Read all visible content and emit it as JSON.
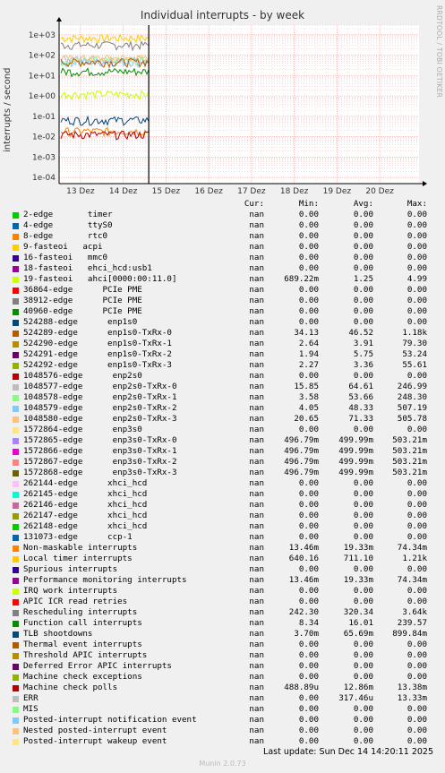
{
  "title": "Individual interrupts - by week",
  "side_credit": "RRDTOOL / TOBI OETIKER",
  "footer": "Last update: Sun Dec 14 14:20:11 2025",
  "version": "Munin 2.0.73",
  "headers": {
    "cur": "Cur:",
    "min": "Min:",
    "avg": "Avg:",
    "max": "Max:"
  },
  "chart_data": {
    "type": "line",
    "ylabel": "interrupts / second",
    "yscale": "log",
    "ylim": [
      5e-05,
      3000
    ],
    "yticks": [
      "1e-04",
      "1e-03",
      "1e-02",
      "1e-01",
      "1e+00",
      "1e+01",
      "1e+02",
      "1e+03"
    ],
    "xticks": [
      "13 Dez",
      "14 Dez",
      "15 Dez",
      "16 Dez",
      "17 Dez",
      "18 Dez",
      "19 Dez",
      "20 Dez"
    ],
    "now_marker": "14 Dez 14:20",
    "grid": true,
    "series": [
      {
        "name": "Local timer interrupts",
        "level": 700
      },
      {
        "name": "Rescheduling interrupts",
        "level": 320
      },
      {
        "name": "1048577-edge enp2s0-TxRx-0",
        "level": 65
      },
      {
        "name": "1048578-edge enp2s0-TxRx-1",
        "level": 54
      },
      {
        "name": "1048579-edge enp2s0-TxRx-2",
        "level": 48
      },
      {
        "name": "1048580-edge enp2s0-TxRx-3",
        "level": 71
      },
      {
        "name": "524289-edge enp1s0-TxRx-0",
        "level": 47
      },
      {
        "name": "Function call interrupts",
        "level": 16
      },
      {
        "name": "19-fasteoi ahci[0000:00:11.0]",
        "level": 1.25
      },
      {
        "name": "TLB shootdowns",
        "level": 0.066
      },
      {
        "name": "Non-maskable interrupts",
        "level": 0.019
      },
      {
        "name": "Machine check polls",
        "level": 0.013
      }
    ]
  },
  "rows": [
    {
      "name": "2-edge       timer",
      "color": "#00cc00",
      "cur": "nan",
      "min": "0.00",
      "avg": "0.00",
      "max": "0.00"
    },
    {
      "name": "4-edge       ttyS0",
      "color": "#0066b3",
      "cur": "nan",
      "min": "0.00",
      "avg": "0.00",
      "max": "0.00"
    },
    {
      "name": "8-edge       rtc0",
      "color": "#ff8000",
      "cur": "nan",
      "min": "0.00",
      "avg": "0.00",
      "max": "0.00"
    },
    {
      "name": "9-fasteoi   acpi",
      "color": "#ffcc00",
      "cur": "nan",
      "min": "0.00",
      "avg": "0.00",
      "max": "0.00"
    },
    {
      "name": "16-fasteoi   mmc0",
      "color": "#330099",
      "cur": "nan",
      "min": "0.00",
      "avg": "0.00",
      "max": "0.00"
    },
    {
      "name": "18-fasteoi   ehci_hcd:usb1",
      "color": "#990099",
      "cur": "nan",
      "min": "0.00",
      "avg": "0.00",
      "max": "0.00"
    },
    {
      "name": "19-fasteoi   ahci[0000:00:11.0]",
      "color": "#ccff00",
      "cur": "nan",
      "min": "689.22m",
      "avg": "1.25",
      "max": "4.99"
    },
    {
      "name": "36864-edge      PCIe PME",
      "color": "#ff0000",
      "cur": "nan",
      "min": "0.00",
      "avg": "0.00",
      "max": "0.00"
    },
    {
      "name": "38912-edge      PCIe PME",
      "color": "#808080",
      "cur": "nan",
      "min": "0.00",
      "avg": "0.00",
      "max": "0.00"
    },
    {
      "name": "40960-edge      PCIe PME",
      "color": "#008f00",
      "cur": "nan",
      "min": "0.00",
      "avg": "0.00",
      "max": "0.00"
    },
    {
      "name": "524288-edge      enp1s0",
      "color": "#00487d",
      "cur": "nan",
      "min": "0.00",
      "avg": "0.00",
      "max": "0.00"
    },
    {
      "name": "524289-edge      enp1s0-TxRx-0",
      "color": "#b35a00",
      "cur": "nan",
      "min": "34.13",
      "avg": "46.52",
      "max": "1.18k"
    },
    {
      "name": "524290-edge      enp1s0-TxRx-1",
      "color": "#b38f00",
      "cur": "nan",
      "min": "2.64",
      "avg": "3.91",
      "max": "79.30"
    },
    {
      "name": "524291-edge      enp1s0-TxRx-2",
      "color": "#6b006b",
      "cur": "nan",
      "min": "1.94",
      "avg": "5.75",
      "max": "53.24"
    },
    {
      "name": "524292-edge      enp1s0-TxRx-3",
      "color": "#8fb300",
      "cur": "nan",
      "min": "2.27",
      "avg": "3.36",
      "max": "55.61"
    },
    {
      "name": "1048576-edge      enp2s0",
      "color": "#b30000",
      "cur": "nan",
      "min": "0.00",
      "avg": "0.00",
      "max": "0.00"
    },
    {
      "name": "1048577-edge      enp2s0-TxRx-0",
      "color": "#bebebe",
      "cur": "nan",
      "min": "15.85",
      "avg": "64.61",
      "max": "246.99"
    },
    {
      "name": "1048578-edge      enp2s0-TxRx-1",
      "color": "#80ff80",
      "cur": "nan",
      "min": "3.58",
      "avg": "53.66",
      "max": "248.30"
    },
    {
      "name": "1048579-edge      enp2s0-TxRx-2",
      "color": "#80c9ff",
      "cur": "nan",
      "min": "4.05",
      "avg": "48.33",
      "max": "507.19"
    },
    {
      "name": "1048580-edge      enp2s0-TxRx-3",
      "color": "#ffc080",
      "cur": "nan",
      "min": "20.65",
      "avg": "71.33",
      "max": "505.78"
    },
    {
      "name": "1572864-edge      enp3s0",
      "color": "#ffe680",
      "cur": "nan",
      "min": "0.00",
      "avg": "0.00",
      "max": "0.00"
    },
    {
      "name": "1572865-edge      enp3s0-TxRx-0",
      "color": "#aa80ff",
      "cur": "nan",
      "min": "496.79m",
      "avg": "499.99m",
      "max": "503.21m"
    },
    {
      "name": "1572866-edge      enp3s0-TxRx-1",
      "color": "#ee00cc",
      "cur": "nan",
      "min": "496.79m",
      "avg": "499.99m",
      "max": "503.21m"
    },
    {
      "name": "1572867-edge      enp3s0-TxRx-2",
      "color": "#ff8080",
      "cur": "nan",
      "min": "496.79m",
      "avg": "499.99m",
      "max": "503.21m"
    },
    {
      "name": "1572868-edge      enp3s0-TxRx-3",
      "color": "#666600",
      "cur": "nan",
      "min": "496.79m",
      "avg": "499.99m",
      "max": "503.21m"
    },
    {
      "name": "262144-edge      xhci_hcd",
      "color": "#ffbfff",
      "cur": "nan",
      "min": "0.00",
      "avg": "0.00",
      "max": "0.00"
    },
    {
      "name": "262145-edge      xhci_hcd",
      "color": "#00ffcc",
      "cur": "nan",
      "min": "0.00",
      "avg": "0.00",
      "max": "0.00"
    },
    {
      "name": "262146-edge      xhci_hcd",
      "color": "#cc6699",
      "cur": "nan",
      "min": "0.00",
      "avg": "0.00",
      "max": "0.00"
    },
    {
      "name": "262147-edge      xhci_hcd",
      "color": "#999900",
      "cur": "nan",
      "min": "0.00",
      "avg": "0.00",
      "max": "0.00"
    },
    {
      "name": "262148-edge      xhci_hcd",
      "color": "#00cc00",
      "cur": "nan",
      "min": "0.00",
      "avg": "0.00",
      "max": "0.00"
    },
    {
      "name": "131073-edge      ccp-1",
      "color": "#0066b3",
      "cur": "nan",
      "min": "0.00",
      "avg": "0.00",
      "max": "0.00"
    },
    {
      "name": "Non-maskable interrupts",
      "color": "#ff8000",
      "cur": "nan",
      "min": "13.46m",
      "avg": "19.33m",
      "max": "74.34m"
    },
    {
      "name": "Local timer interrupts",
      "color": "#ffcc00",
      "cur": "nan",
      "min": "640.16",
      "avg": "711.10",
      "max": "1.21k"
    },
    {
      "name": "Spurious interrupts",
      "color": "#330099",
      "cur": "nan",
      "min": "0.00",
      "avg": "0.00",
      "max": "0.00"
    },
    {
      "name": "Performance monitoring interrupts",
      "color": "#990099",
      "cur": "nan",
      "min": "13.46m",
      "avg": "19.33m",
      "max": "74.34m"
    },
    {
      "name": "IRQ work interrupts",
      "color": "#ccff00",
      "cur": "nan",
      "min": "0.00",
      "avg": "0.00",
      "max": "0.00"
    },
    {
      "name": "APIC ICR read retries",
      "color": "#ff0000",
      "cur": "nan",
      "min": "0.00",
      "avg": "0.00",
      "max": "0.00"
    },
    {
      "name": "Rescheduling interrupts",
      "color": "#808080",
      "cur": "nan",
      "min": "242.30",
      "avg": "320.34",
      "max": "3.64k"
    },
    {
      "name": "Function call interrupts",
      "color": "#008f00",
      "cur": "nan",
      "min": "8.34",
      "avg": "16.01",
      "max": "239.57"
    },
    {
      "name": "TLB shootdowns",
      "color": "#00487d",
      "cur": "nan",
      "min": "3.70m",
      "avg": "65.69m",
      "max": "899.84m"
    },
    {
      "name": "Thermal event interrupts",
      "color": "#b35a00",
      "cur": "nan",
      "min": "0.00",
      "avg": "0.00",
      "max": "0.00"
    },
    {
      "name": "Threshold APIC interrupts",
      "color": "#b38f00",
      "cur": "nan",
      "min": "0.00",
      "avg": "0.00",
      "max": "0.00"
    },
    {
      "name": "Deferred Error APIC interrupts",
      "color": "#6b006b",
      "cur": "nan",
      "min": "0.00",
      "avg": "0.00",
      "max": "0.00"
    },
    {
      "name": "Machine check exceptions",
      "color": "#8fb300",
      "cur": "nan",
      "min": "0.00",
      "avg": "0.00",
      "max": "0.00"
    },
    {
      "name": "Machine check polls",
      "color": "#b30000",
      "cur": "nan",
      "min": "488.89u",
      "avg": "12.86m",
      "max": "13.38m"
    },
    {
      "name": "ERR",
      "color": "#bebebe",
      "cur": "nan",
      "min": "0.00",
      "avg": "317.46u",
      "max": "13.33m"
    },
    {
      "name": "MIS",
      "color": "#80ff80",
      "cur": "nan",
      "min": "0.00",
      "avg": "0.00",
      "max": "0.00"
    },
    {
      "name": "Posted-interrupt notification event",
      "color": "#80c9ff",
      "cur": "nan",
      "min": "0.00",
      "avg": "0.00",
      "max": "0.00"
    },
    {
      "name": "Nested posted-interrupt event",
      "color": "#ffc080",
      "cur": "nan",
      "min": "0.00",
      "avg": "0.00",
      "max": "0.00"
    },
    {
      "name": "Posted-interrupt wakeup event",
      "color": "#ffe680",
      "cur": "nan",
      "min": "0.00",
      "avg": "0.00",
      "max": "0.00"
    }
  ]
}
